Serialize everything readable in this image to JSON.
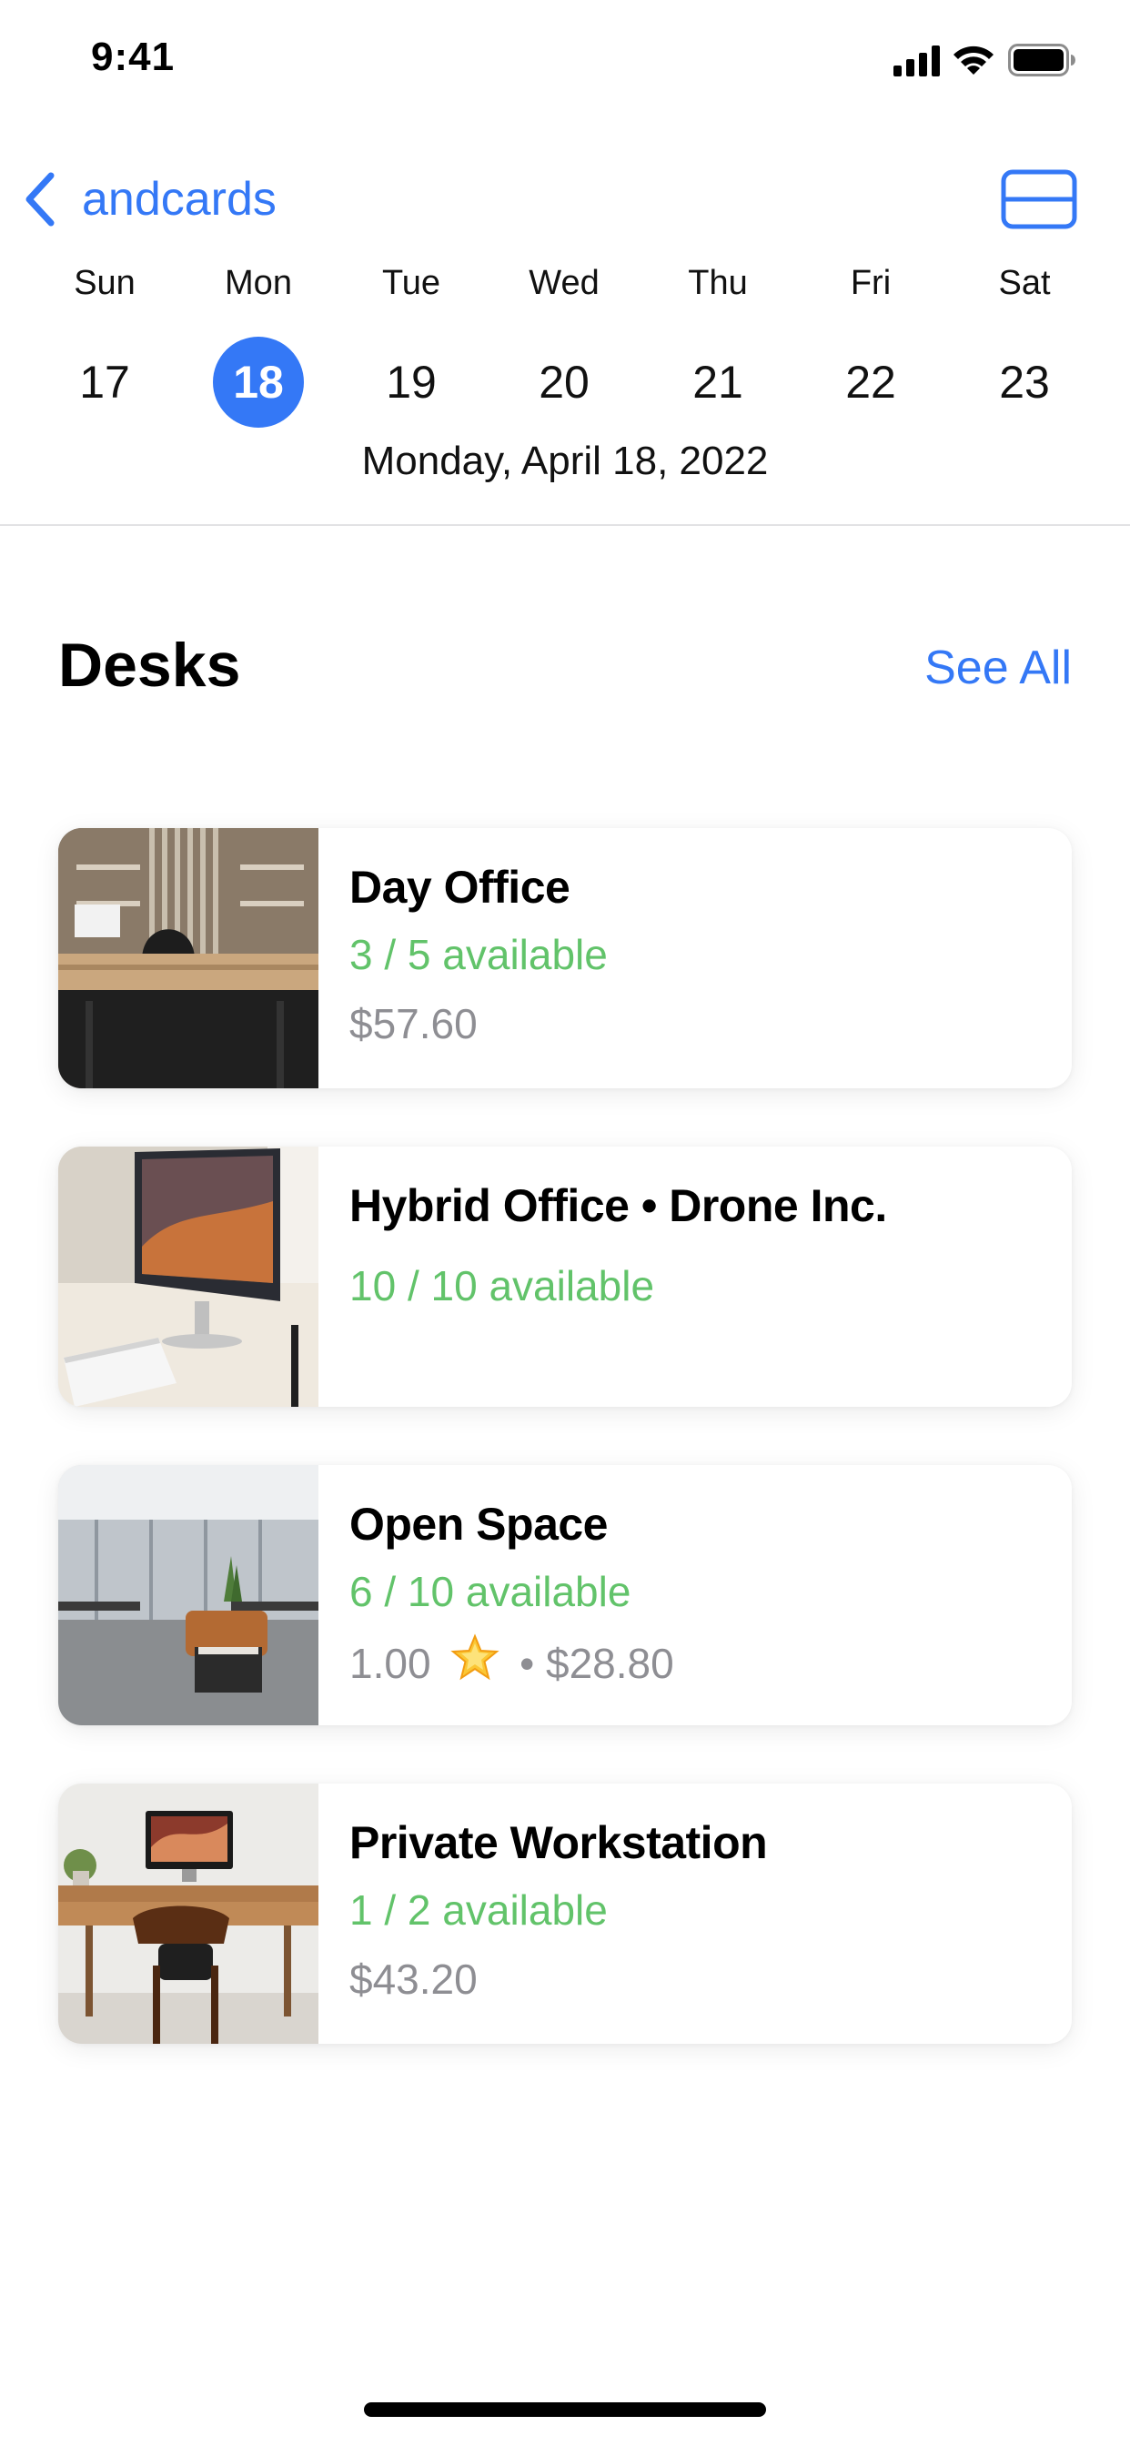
{
  "status_bar": {
    "time": "9:41",
    "icons": [
      "cellular-signal-icon",
      "wifi-icon",
      "battery-icon"
    ]
  },
  "nav": {
    "back_label": "andcards",
    "back_icon": "chevron-left-icon",
    "right_icon": "card-view-icon"
  },
  "calendar": {
    "days": [
      {
        "name": "Sun",
        "number": "17"
      },
      {
        "name": "Mon",
        "number": "18",
        "selected": true
      },
      {
        "name": "Tue",
        "number": "19"
      },
      {
        "name": "Wed",
        "number": "20"
      },
      {
        "name": "Thu",
        "number": "21"
      },
      {
        "name": "Fri",
        "number": "22"
      },
      {
        "name": "Sat",
        "number": "23"
      }
    ],
    "full_date": "Monday, April 18, 2022"
  },
  "section": {
    "title": "Desks",
    "see_all": "See All"
  },
  "desks": [
    {
      "title": "Day Office",
      "availability": "3 / 5 available",
      "price": "$57.60"
    },
    {
      "title": "Hybrid Office • Drone Inc.",
      "availability": "10 / 10 available"
    },
    {
      "title": "Open Space",
      "availability": "6 / 10 available",
      "rating": "1.00",
      "rating_icon": "star-icon",
      "separator": "•",
      "price": "$28.80"
    },
    {
      "title": "Private Workstation",
      "availability": "1 / 2 available",
      "price": "$43.20"
    }
  ],
  "colors": {
    "accent": "#3478f6",
    "available": "#62c36a",
    "secondary_text": "#8e8e93"
  }
}
